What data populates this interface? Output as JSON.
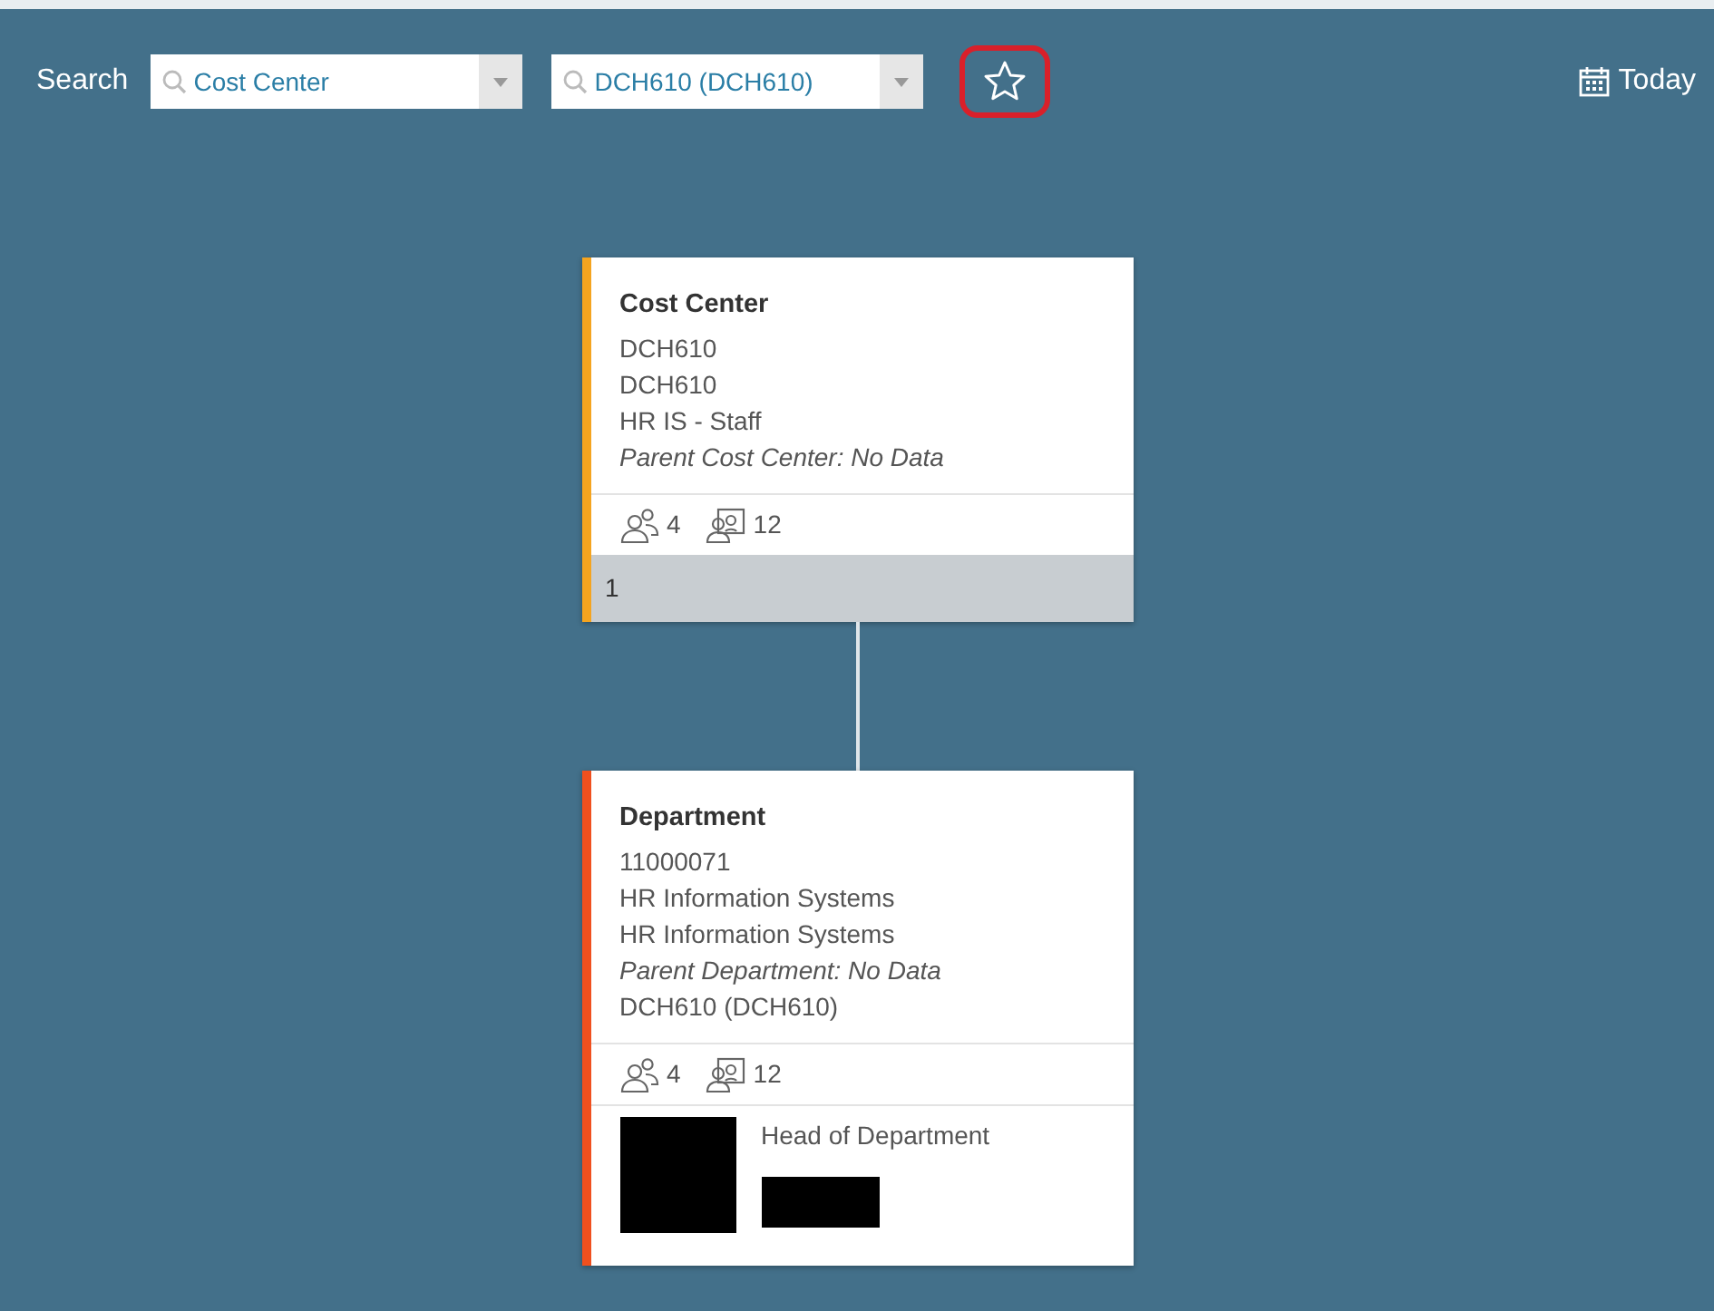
{
  "toolbar": {
    "label": "Search",
    "fields": [
      {
        "value": "Cost Center"
      },
      {
        "value": "DCH610 (DCH610)"
      }
    ],
    "favorite": {
      "highlighted": true
    },
    "today": "Today"
  },
  "nodes": [
    {
      "title": "Cost Center",
      "color": "#f5a41f",
      "lines": [
        {
          "text": "DCH610",
          "italic": false
        },
        {
          "text": "DCH610",
          "italic": false
        },
        {
          "text": "HR IS - Staff",
          "italic": false
        },
        {
          "text": "Parent Cost Center: No Data",
          "italic": true
        }
      ],
      "counts": [
        "4",
        "12"
      ],
      "footer": "1"
    },
    {
      "title": "Department",
      "color": "#f0501e",
      "lines": [
        {
          "text": "11000071",
          "italic": false
        },
        {
          "text": "HR Information Systems",
          "italic": false
        },
        {
          "text": "HR Information Systems",
          "italic": false
        },
        {
          "text": "Parent Department: No Data",
          "italic": true
        },
        {
          "text": "DCH610 (DCH610)",
          "italic": false
        }
      ],
      "counts": [
        "4",
        "12"
      ],
      "head": {
        "role": "Head of Department"
      }
    }
  ]
}
